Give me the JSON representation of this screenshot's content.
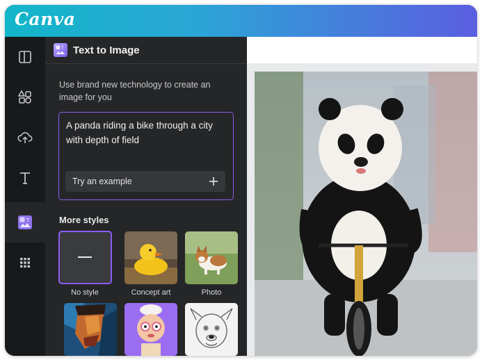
{
  "app": {
    "logo_text": "Canva"
  },
  "rail": {
    "items": [
      {
        "icon": "layout-icon"
      },
      {
        "icon": "elements-icon"
      },
      {
        "icon": "upload-icon"
      },
      {
        "icon": "text-icon"
      },
      {
        "icon": "text-to-image-icon",
        "active": true
      },
      {
        "icon": "apps-icon"
      }
    ]
  },
  "panel": {
    "title": "Text to Image",
    "description": "Use brand new technology to create an image for you",
    "prompt_value": "A panda riding a bike through a city with depth of field",
    "example_button": "Try an example",
    "styles_heading": "More styles",
    "styles": [
      {
        "label": "No style",
        "selected": true
      },
      {
        "label": "Concept art",
        "selected": false
      },
      {
        "label": "Photo",
        "selected": false
      },
      {
        "label": "",
        "selected": false
      },
      {
        "label": "",
        "selected": false
      },
      {
        "label": "",
        "selected": false
      }
    ]
  },
  "colors": {
    "accent": "#8b5cf6",
    "topbar_start": "#12b6c9",
    "topbar_end": "#5b5ee0",
    "panel_bg": "#252627",
    "rail_bg": "#18191b"
  }
}
